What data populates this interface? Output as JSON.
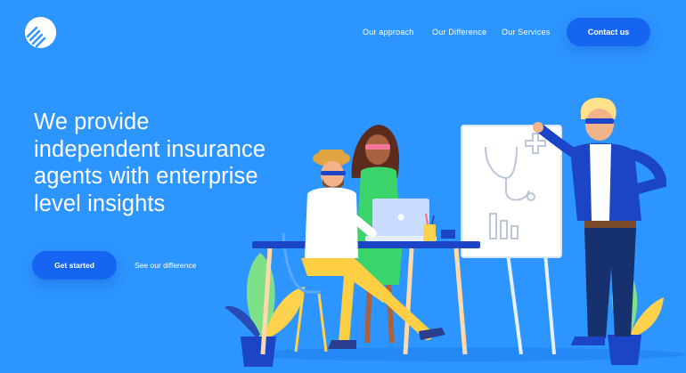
{
  "brand": {
    "logo_icon": "striped-circle-logo-icon"
  },
  "nav": {
    "links": [
      {
        "label": "Our approach"
      },
      {
        "label": "Our Difference"
      },
      {
        "label": "Our Services"
      }
    ],
    "contact_label": "Contact us"
  },
  "hero": {
    "headline_lines": [
      "We provide",
      "independent insurance",
      "agents with enterprise",
      "level insights"
    ],
    "primary_cta": "Get started",
    "secondary_cta": "See our difference"
  },
  "colors": {
    "background": "#2d95ff",
    "button": "#1565f2",
    "text": "#ffffff"
  }
}
